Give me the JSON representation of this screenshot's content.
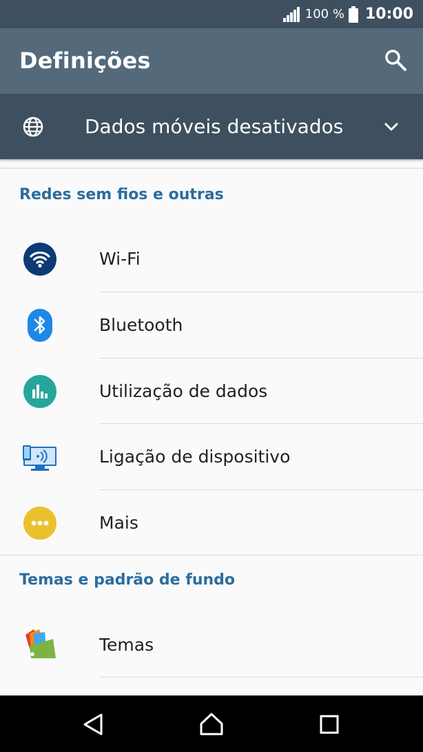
{
  "status_bar": {
    "battery_percent": "100 %",
    "time": "10:00",
    "icons": [
      "signal-icon",
      "battery-icon"
    ]
  },
  "app_bar": {
    "title": "Definições",
    "search_icon": "search-icon"
  },
  "data_banner": {
    "text": "Dados móveis desativados",
    "icon": "globe-icon",
    "expand_icon": "chevron-down-icon"
  },
  "sections": [
    {
      "header": "Redes sem fios e outras",
      "items": [
        {
          "label": "Wi-Fi",
          "icon": "wifi-icon"
        },
        {
          "label": "Bluetooth",
          "icon": "bluetooth-icon"
        },
        {
          "label": "Utilização de dados",
          "icon": "data-usage-icon"
        },
        {
          "label": "Ligação de dispositivo",
          "icon": "device-connection-icon"
        },
        {
          "label": "Mais",
          "icon": "more-icon"
        }
      ]
    },
    {
      "header": "Temas e padrão de fundo",
      "items": [
        {
          "label": "Temas",
          "icon": "themes-icon"
        }
      ]
    }
  ],
  "nav_bar": {
    "buttons": [
      "back-icon",
      "home-icon",
      "recents-icon"
    ]
  },
  "colors": {
    "status_bar": "#3e5060",
    "app_bar": "#546a7b",
    "section_header": "#2c6d9e",
    "wifi": "#0d3a73",
    "bluetooth": "#1e88e5",
    "data_usage": "#26a69a",
    "more": "#e8c12d"
  }
}
